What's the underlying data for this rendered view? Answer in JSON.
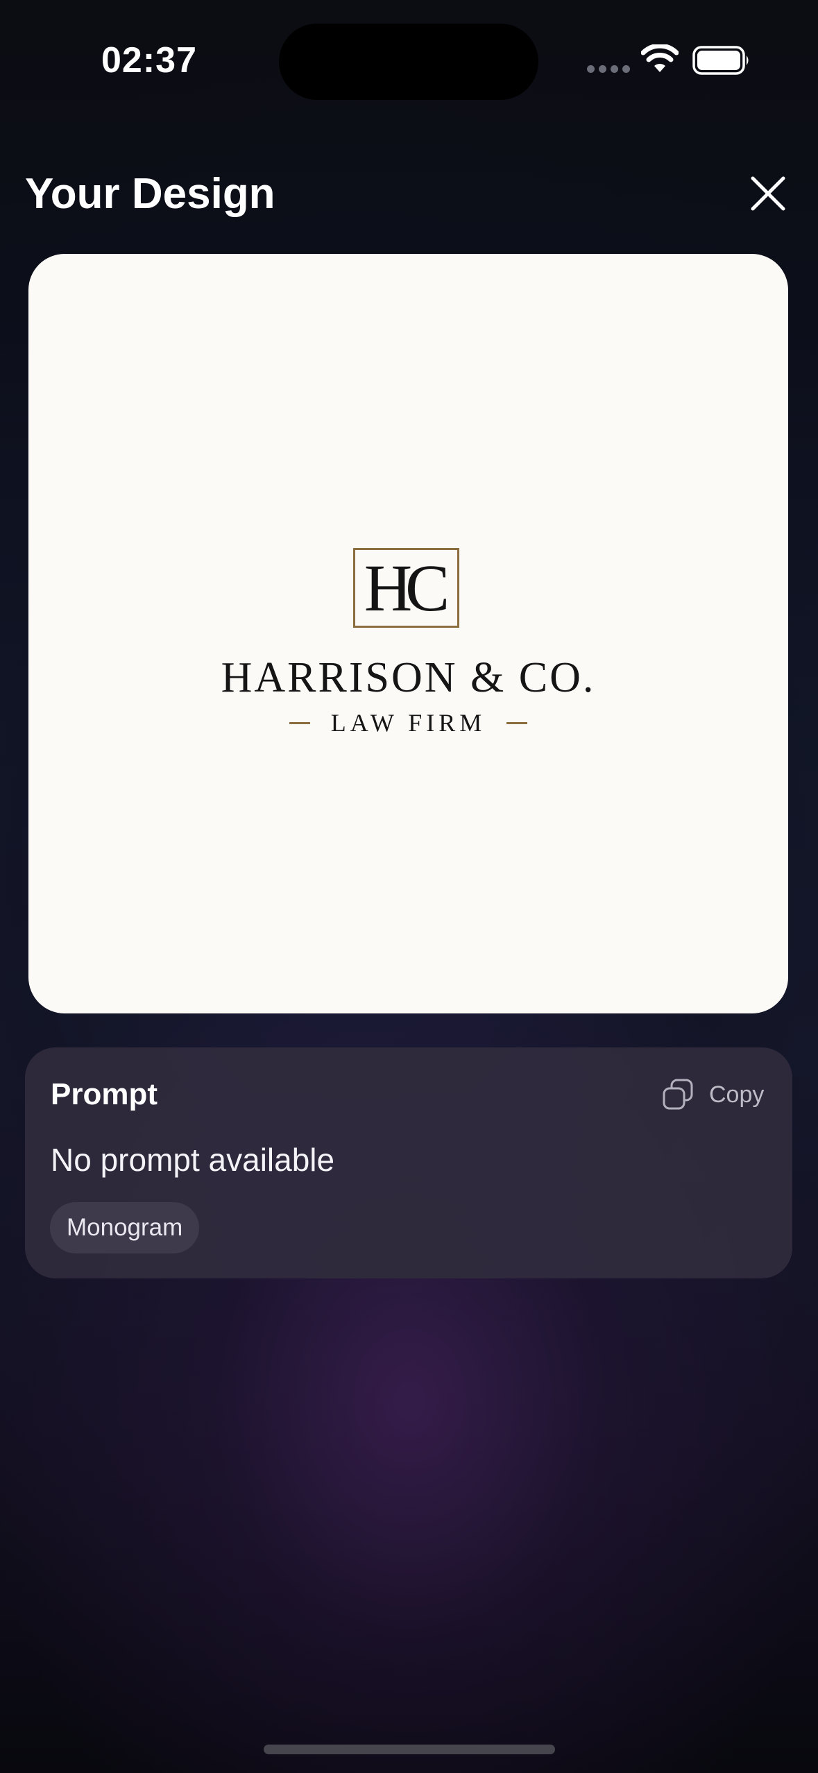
{
  "status_bar": {
    "time": "02:37",
    "signal_icon": "cellular-signal-icon",
    "wifi_icon": "wifi-icon",
    "battery_icon": "battery-icon"
  },
  "header": {
    "title": "Your Design",
    "close_icon": "close-icon"
  },
  "design": {
    "monogram": "HC",
    "name": "HARRISON & CO.",
    "tagline": "LAW FIRM",
    "colors": {
      "background": "#fbfaf7",
      "accent": "#8c6d3f",
      "text": "#151515"
    }
  },
  "prompt": {
    "heading": "Prompt",
    "copy_label": "Copy",
    "copy_icon": "copy-icon",
    "text": "No prompt available",
    "tags": [
      "Monogram"
    ]
  },
  "theme": {
    "panel_color": "#2f2b3c",
    "chip_color": "#3e3a4c"
  }
}
